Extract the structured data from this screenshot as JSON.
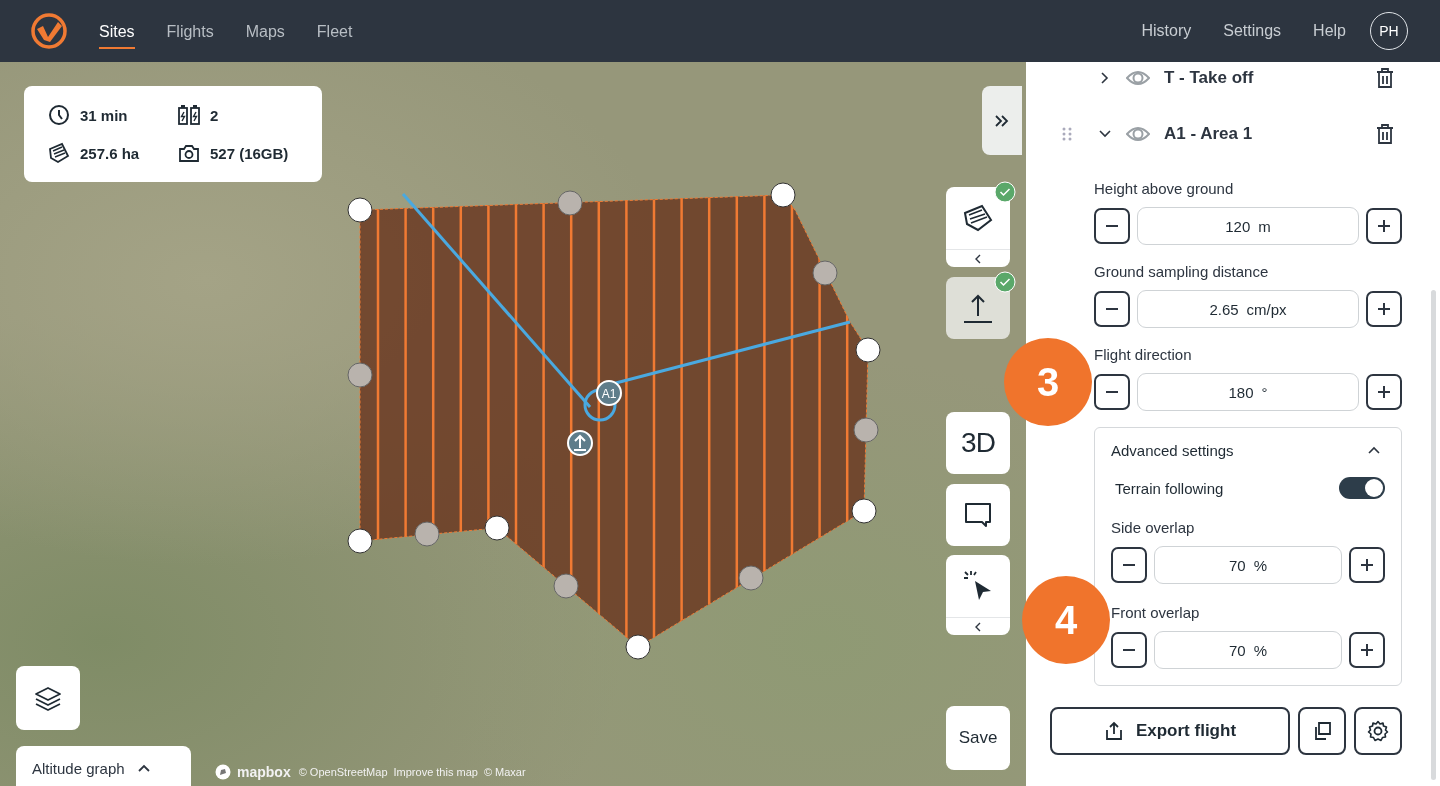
{
  "nav": {
    "tabs": [
      {
        "label": "Sites",
        "selected": true
      },
      {
        "label": "Flights",
        "selected": false
      },
      {
        "label": "Maps",
        "selected": false
      },
      {
        "label": "Fleet",
        "selected": false
      }
    ],
    "links": [
      "History",
      "Settings",
      "Help"
    ],
    "avatar": "PH"
  },
  "stats": [
    {
      "kind": "time",
      "value": "31 min"
    },
    {
      "kind": "batteries",
      "value": "2"
    },
    {
      "kind": "area",
      "value": "257.6 ha"
    },
    {
      "kind": "photos",
      "value": "527 (16GB)"
    }
  ],
  "map": {
    "area_marker": "A1",
    "tools": [
      {
        "kind": "area",
        "done": true,
        "submenu": true,
        "active": true
      },
      {
        "kind": "takeoff",
        "done": true,
        "submenu": false,
        "active": false
      },
      {
        "kind": "view3d",
        "label": "3D",
        "done": false,
        "submenu": false,
        "active": true
      },
      {
        "kind": "comment",
        "done": false,
        "submenu": false,
        "active": true
      },
      {
        "kind": "select",
        "done": false,
        "submenu": true,
        "active": true
      }
    ],
    "save_button": "Save",
    "altitude_graph": {
      "label": "Altitude graph",
      "expanded": false
    },
    "attribution": {
      "logo": "mapbox",
      "items": [
        "© OpenStreetMap",
        "Improve this map",
        "© Maxar"
      ]
    }
  },
  "panel": {
    "items": [
      {
        "label": "T - Take off",
        "expanded": false,
        "draggable": false
      },
      {
        "label": "A1 - Area 1",
        "expanded": true,
        "draggable": true
      }
    ],
    "fields": [
      {
        "label": "Height above ground",
        "value": "120",
        "unit": "m"
      },
      {
        "label": "Ground sampling distance",
        "value": "2.65",
        "unit": "cm/px"
      },
      {
        "label": "Flight direction",
        "value": "180",
        "unit": "°"
      }
    ],
    "advanced": {
      "title": "Advanced settings",
      "expanded": true,
      "toggle": {
        "label": "Terrain following",
        "on": true
      },
      "fields": [
        {
          "label": "Side overlap",
          "value": "70",
          "unit": "%"
        },
        {
          "label": "Front overlap",
          "value": "70",
          "unit": "%"
        }
      ]
    },
    "export_button": "Export flight"
  },
  "callouts": [
    "3",
    "4"
  ]
}
